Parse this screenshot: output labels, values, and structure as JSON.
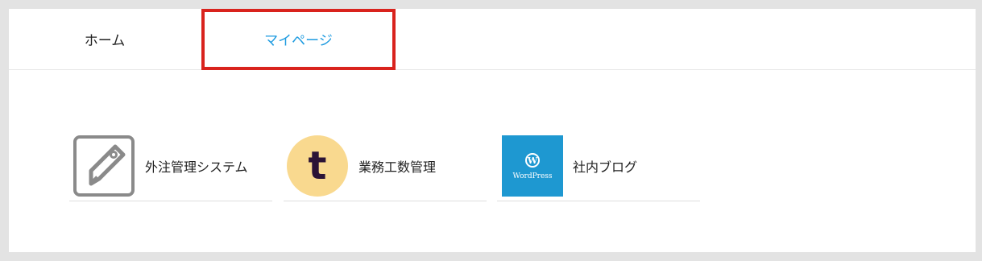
{
  "tabs": {
    "home": "ホーム",
    "mypage": "マイページ"
  },
  "apps": [
    {
      "label": "外注管理システム",
      "icon": "tag-icon"
    },
    {
      "label": "業務工数管理",
      "icon": "t-logo-icon",
      "icon_text": "t"
    },
    {
      "label": "社内ブログ",
      "icon": "wordpress-icon",
      "icon_text": "WordPress"
    }
  ],
  "colors": {
    "active_tab": "#1e9be0",
    "highlight": "#d9231d",
    "wordpress_bg": "#1e98d1",
    "t_logo_bg": "#f9d98f",
    "t_logo_fg": "#2b1336"
  }
}
